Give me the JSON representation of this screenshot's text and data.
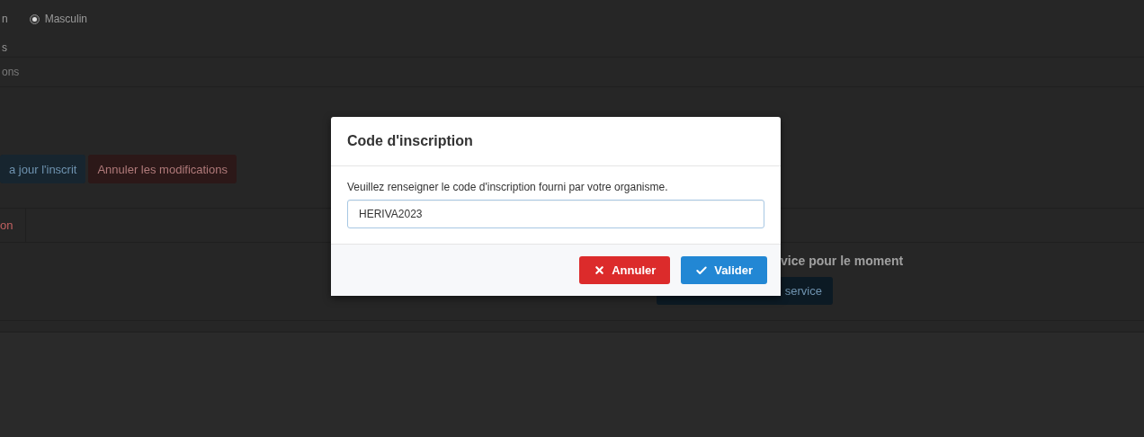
{
  "background": {
    "gender": {
      "label_fragment": "n",
      "option": "Masculin",
      "selected": true
    },
    "row_fragment": "s",
    "field_fragment": "ons",
    "buttons": [
      {
        "label": "a jour l'inscrit",
        "kind": "primary"
      },
      {
        "label": "Annuler les modifications",
        "kind": "danger"
      }
    ],
    "tab_fragment": "on",
    "empty_message": "vice pour le moment",
    "action_button": "service"
  },
  "dialog": {
    "title": "Code d'inscription",
    "prompt": "Veuillez renseigner le code d'inscription fourni par votre organisme.",
    "code": "HERIVA2023",
    "buttons": [
      {
        "label": "Annuler",
        "kind": "cancel"
      },
      {
        "label": "Valider",
        "kind": "confirm"
      }
    ]
  }
}
